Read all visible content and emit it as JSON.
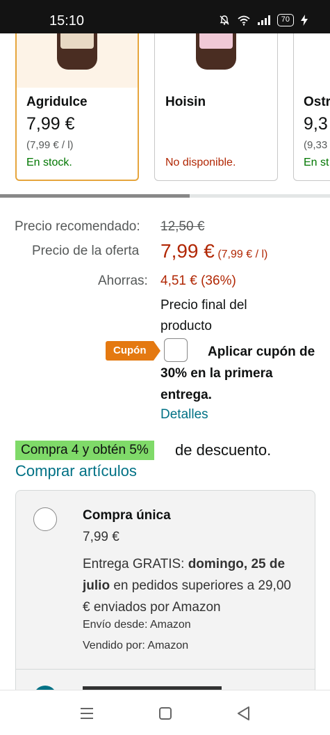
{
  "status_bar": {
    "time": "15:10",
    "battery": "70",
    "icons": [
      "bell-off-icon",
      "wifi-icon",
      "signal-icon",
      "battery-icon",
      "charging-icon"
    ]
  },
  "variants": [
    {
      "name": "Agridulce",
      "price": "7,99 €",
      "unit_price": "(7,99 € / l)",
      "availability": "En stock.",
      "selected": true
    },
    {
      "name": "Hoisin",
      "price": "",
      "unit_price": "",
      "availability": "No disponible.",
      "selected": false
    },
    {
      "name": "Ostr",
      "price": "9,3",
      "unit_price": "(9,33",
      "availability": "En st",
      "selected": false
    }
  ],
  "pricing": {
    "recommended_label": "Precio recomendado:",
    "recommended_value": "12,50 €",
    "offer_label": "Precio de la oferta",
    "offer_value": "7,99 €",
    "offer_unit": "(7,99 € / l)",
    "savings_label": "Ahorras:",
    "savings_value": "4,51 € (36%)",
    "final_price_note": "Precio final del producto"
  },
  "coupon": {
    "badge": "Cupón",
    "text": "Aplicar cupón de 30% en la primera entrega.",
    "details_link": "Detalles"
  },
  "promo": {
    "highlight": "Compra 4 y obtén 5%",
    "rest": "de descuento.",
    "link": "Comprar artículos"
  },
  "purchase_option": {
    "title": "Compra única",
    "price": "7,99 €",
    "delivery_prefix": "Entrega GRATIS: ",
    "delivery_date": "domingo, 25 de julio",
    "delivery_suffix": " en pedidos superiores a 29,00 € enviados por Amazon",
    "ships_from": "Envío desde: Amazon",
    "sold_by": "Vendido por: Amazon"
  },
  "nav_bar": {
    "icons": [
      "menu-icon",
      "home-icon",
      "back-icon"
    ]
  }
}
